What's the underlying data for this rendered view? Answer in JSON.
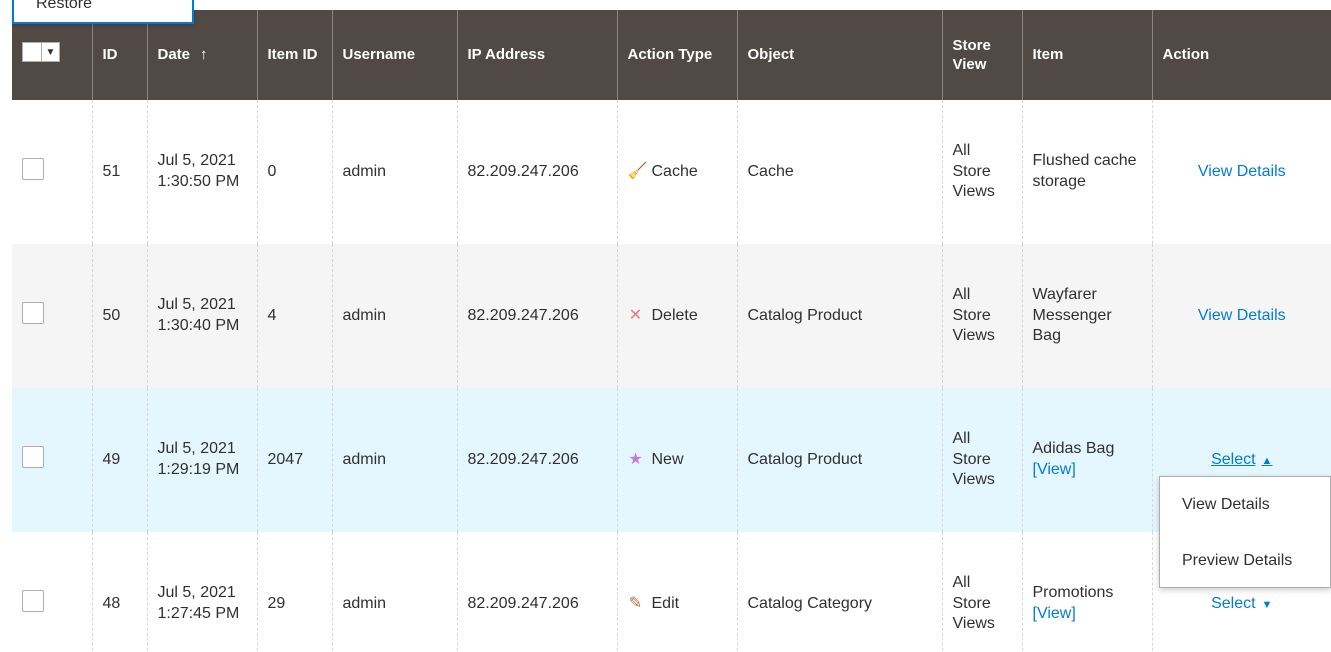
{
  "mass_action": {
    "restore_label": "Restore"
  },
  "columns": {
    "id": "ID",
    "date": "Date",
    "date_sort": "↑",
    "item_id": "Item ID",
    "username": "Username",
    "ip": "IP Address",
    "action_type": "Action Type",
    "object": "Object",
    "store_view": "Store View",
    "item": "Item",
    "action": "Action"
  },
  "rows": [
    {
      "id": "51",
      "date": "Jul 5, 2021 1:30:50 PM",
      "item_id": "0",
      "username": "admin",
      "ip": "82.209.247.206",
      "action_type": "Cache",
      "action_icon": "broom-icon",
      "object": "Cache",
      "store_view": "All Store Views",
      "item": "Flushed cache storage",
      "item_link": "",
      "action": "View Details"
    },
    {
      "id": "50",
      "date": "Jul 5, 2021 1:30:40 PM",
      "item_id": "4",
      "username": "admin",
      "ip": "82.209.247.206",
      "action_type": "Delete",
      "action_icon": "close-icon",
      "object": "Catalog Product",
      "store_view": "All Store Views",
      "item": "Wayfarer Messenger Bag",
      "item_link": "",
      "action": "View Details"
    },
    {
      "id": "49",
      "date": "Jul 5, 2021 1:29:19 PM",
      "item_id": "2047",
      "username": "admin",
      "ip": "82.209.247.206",
      "action_type": "New",
      "action_icon": "star-icon",
      "object": "Catalog Product",
      "store_view": "All Store Views",
      "item": "Adidas Bag",
      "item_link": "[View]",
      "action": "Select"
    },
    {
      "id": "48",
      "date": "Jul 5, 2021 1:27:45 PM",
      "item_id": "29",
      "username": "admin",
      "ip": "82.209.247.206",
      "action_type": "Edit",
      "action_icon": "pencil-icon",
      "object": "Catalog Category",
      "store_view": "All Store Views",
      "item": "Promotions",
      "item_link": "[View]",
      "action": "Select"
    }
  ],
  "action_dropdown": {
    "options": [
      "View Details",
      "Preview Details"
    ]
  },
  "colors": {
    "header_bg": "#514943",
    "link": "#007bdb",
    "active_row": "#e5f7fe",
    "alt_row": "#f5f5f5"
  }
}
